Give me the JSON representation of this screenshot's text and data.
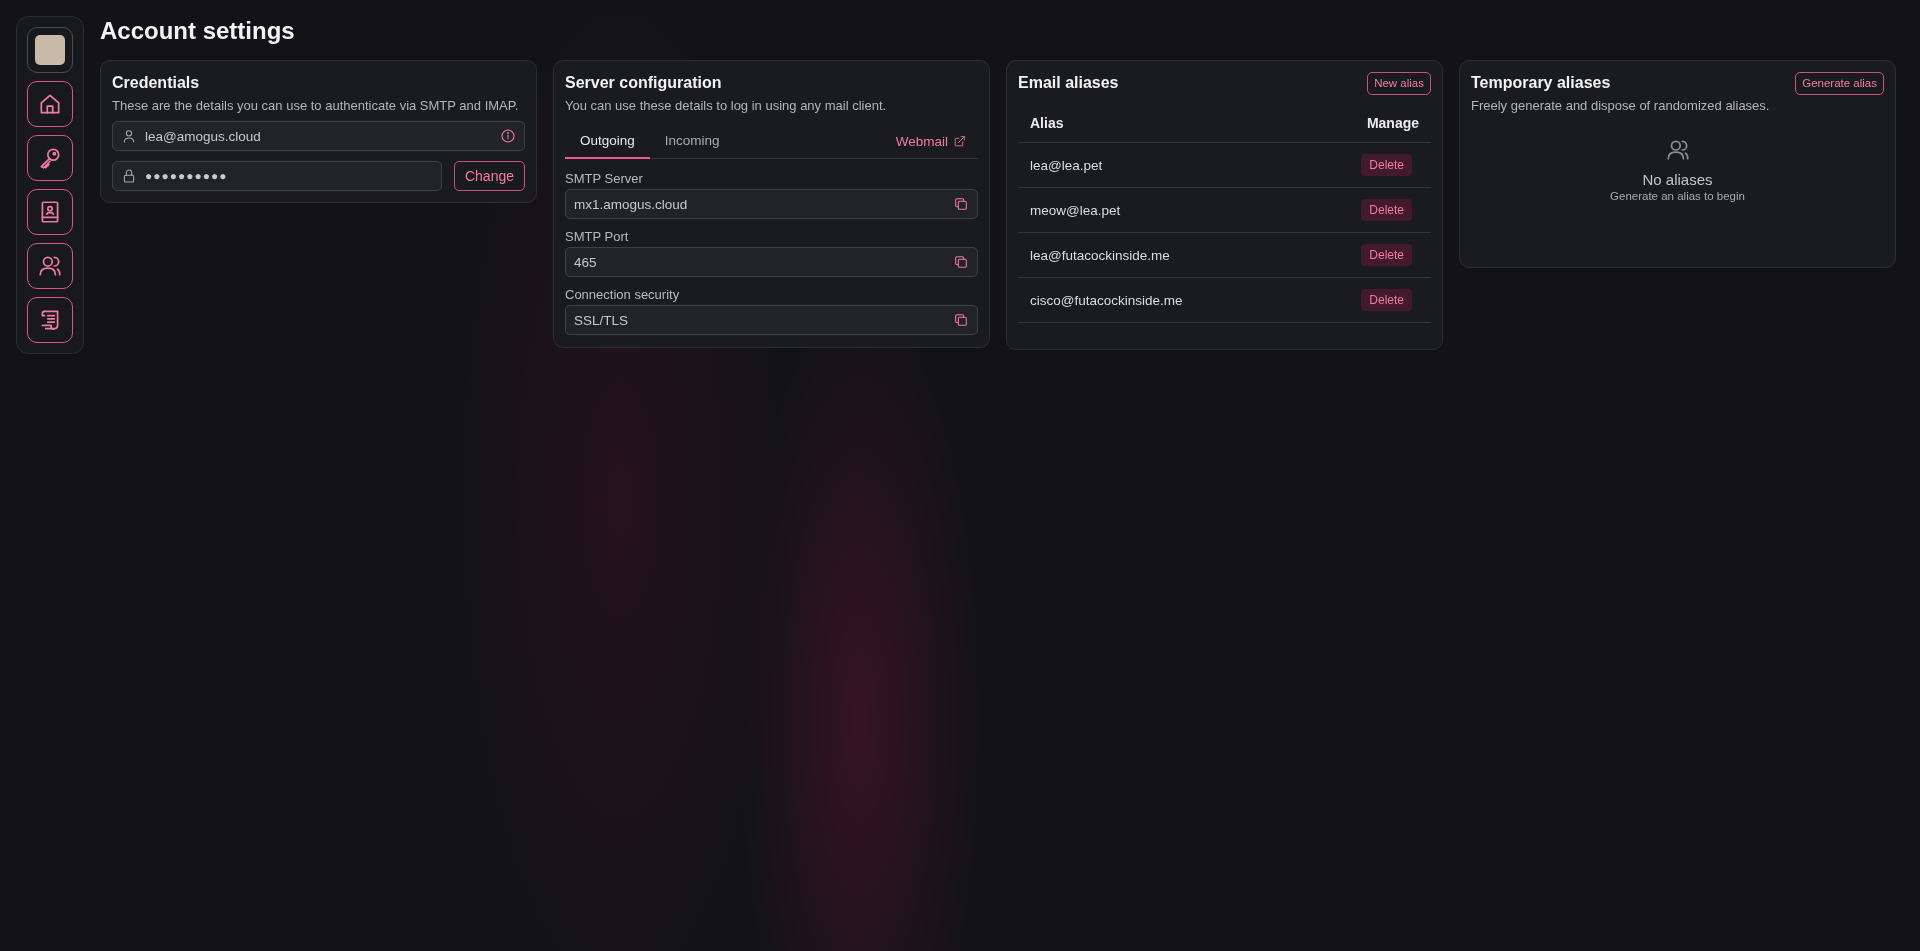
{
  "page": {
    "title": "Account settings"
  },
  "credentials": {
    "title": "Credentials",
    "description": "These are the details you can use to authenticate via SMTP and IMAP.",
    "username": {
      "value": "lea@amogus.cloud"
    },
    "password": {
      "value": "●●●●●●●●●●"
    },
    "change_button": "Change"
  },
  "server_configuration": {
    "title": "Server configuration",
    "description": "You can use these details to log in using any mail client.",
    "tabs": [
      {
        "label": "Outgoing",
        "selected": true
      },
      {
        "label": "Incoming",
        "selected": false
      }
    ],
    "webmail_link": "Webmail",
    "fields": [
      {
        "label": "SMTP Server",
        "value": "mx1.amogus.cloud"
      },
      {
        "label": "SMTP Port",
        "value": "465"
      },
      {
        "label": "Connection security",
        "value": "SSL/TLS"
      }
    ]
  },
  "email_aliases": {
    "title": "Email aliases",
    "new_button": "New alias",
    "columns": [
      "Alias",
      "Manage"
    ],
    "rows": [
      {
        "alias": "lea@lea.pet",
        "action": "Delete"
      },
      {
        "alias": "meow@lea.pet",
        "action": "Delete"
      },
      {
        "alias": "lea@futacockinside.me",
        "action": "Delete"
      },
      {
        "alias": "cisco@futacockinside.me",
        "action": "Delete"
      }
    ]
  },
  "temporary_aliases": {
    "title": "Temporary aliases",
    "generate_button": "Generate alias",
    "description": "Freely generate and dispose of randomized aliases.",
    "empty_title": "No aliases",
    "empty_hint": "Generate an alias to begin"
  }
}
